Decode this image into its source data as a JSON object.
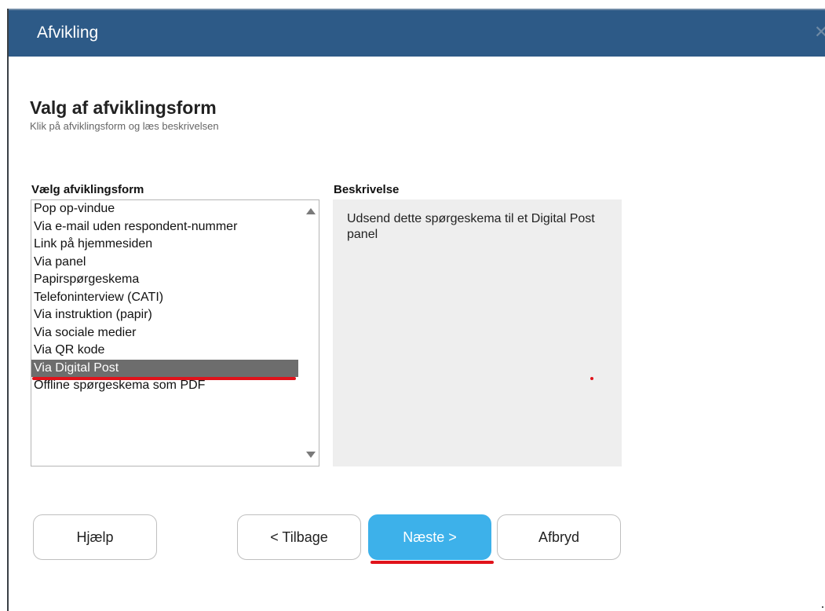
{
  "window": {
    "title": "Afvikling",
    "close_icon": "close-icon"
  },
  "header": {
    "heading": "Valg af afviklingsform",
    "subheading": "Klik på afviklingsform og læs beskrivelsen"
  },
  "list": {
    "label": "Vælg afviklingsform",
    "items": [
      "Pop op-vindue",
      "Via e-mail uden respondent-nummer",
      "Link på hjemmesiden",
      "Via panel",
      "Papirspørgeskema",
      "Telefoninterview (CATI)",
      "Via instruktion (papir)",
      "Via sociale medier",
      "Via QR kode",
      "Via Digital Post",
      "Offline spørgeskema som PDF"
    ],
    "selected": "Via Digital Post"
  },
  "description": {
    "label": "Beskrivelse",
    "text": "Udsend dette spørgeskema til et Digital Post panel"
  },
  "buttons": {
    "help": "Hjælp",
    "back": "< Tilbage",
    "next": "Næste >",
    "cancel": "Afbryd"
  },
  "colors": {
    "titlebar": "#2d5a87",
    "accent_button": "#3db1ea",
    "selection": "#6d6d6d",
    "annotation_red": "#e0131b",
    "description_bg": "#eeeeee"
  }
}
